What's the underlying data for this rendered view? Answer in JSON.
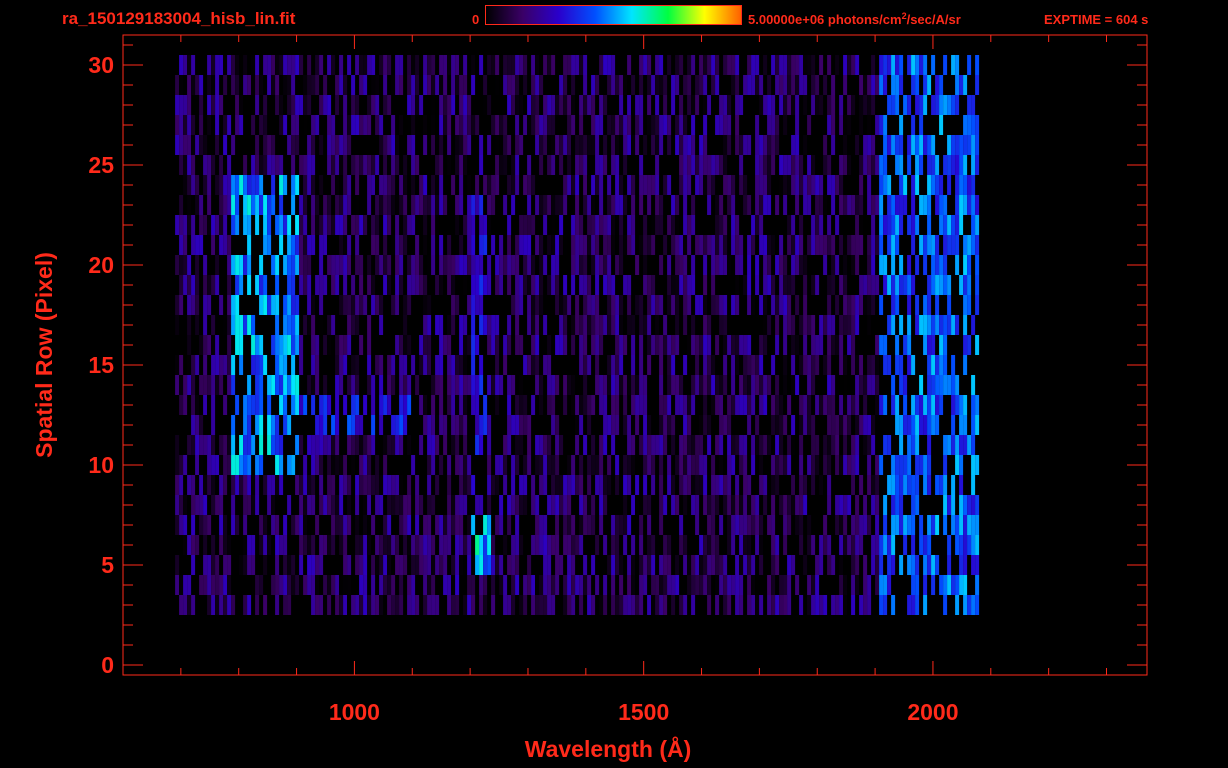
{
  "header": {
    "file_title": "ra_150129183004_hisb_lin.fit",
    "colorbar_min": "0",
    "colorbar_max_prefix": "5.00000e+06 photons/cm",
    "colorbar_max_sup": "2",
    "colorbar_max_suffix": "/sec/A/sr",
    "exptime": "EXPTIME = 604 s"
  },
  "colors": {
    "axis": "#ff2a1a",
    "background": "#000000",
    "colormap": [
      "#000000",
      "#3a0066",
      "#2a00cc",
      "#0050ff",
      "#00e5ff",
      "#00ff40",
      "#ffff00",
      "#ff6000"
    ]
  },
  "chart_data": {
    "type": "heatmap",
    "title": "ra_150129183004_hisb_lin.fit",
    "xlabel": "Wavelength (Å)",
    "ylabel": "Spatial Row (Pixel)",
    "xlim": [
      600,
      2370
    ],
    "ylim": [
      -0.5,
      31.5
    ],
    "xticks": [
      1000,
      1500,
      2000
    ],
    "yticks": [
      0,
      5,
      10,
      15,
      20,
      25,
      30
    ],
    "colorbar": {
      "min": 0,
      "max": 5000000,
      "unit": "photons/cm2/sec/A/sr"
    },
    "data_extent": {
      "x": [
        690,
        2075
      ],
      "rows": [
        3,
        30
      ]
    },
    "features": [
      {
        "x": [
          780,
          900
        ],
        "rows": [
          10,
          24
        ],
        "level": 0.55
      },
      {
        "x": [
          900,
          1100
        ],
        "rows": [
          12,
          13
        ],
        "level": 0.4
      },
      {
        "x": [
          1195,
          1225
        ],
        "rows": [
          5,
          23
        ],
        "level": 0.35
      },
      {
        "x": [
          1195,
          1235
        ],
        "rows": [
          5,
          7
        ],
        "level": 0.6
      },
      {
        "x": [
          1900,
          2075
        ],
        "rows": [
          3,
          30
        ],
        "level": 0.5
      }
    ],
    "background_level": 0.15
  }
}
